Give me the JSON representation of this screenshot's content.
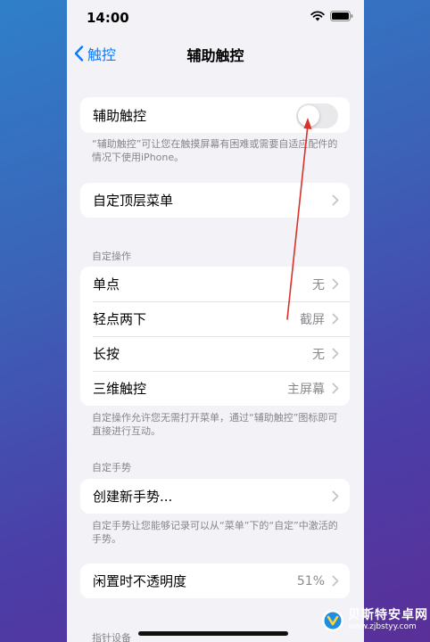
{
  "status_bar": {
    "time": "14:00"
  },
  "nav": {
    "back_label": "触控",
    "title": "辅助触控"
  },
  "assistive_touch": {
    "label": "辅助触控",
    "enabled": false,
    "caption": "“辅助触控”可让您在触摸屏幕有困难或需要自适应配件的情况下使用iPhone。"
  },
  "top_menu": {
    "label": "自定顶层菜单"
  },
  "custom_actions": {
    "header": "自定操作",
    "rows": [
      {
        "label": "单点",
        "value": "无"
      },
      {
        "label": "轻点两下",
        "value": "截屏"
      },
      {
        "label": "长按",
        "value": "无"
      },
      {
        "label": "三维触控",
        "value": "主屏幕"
      }
    ],
    "caption": "自定操作允许您无需打开菜单，通过“辅助触控”图标即可直接进行互动。"
  },
  "custom_gestures": {
    "header": "自定手势",
    "create_label": "创建新手势...",
    "caption": "自定手势让您能够记录可以从“菜单”下的“自定”中激活的手势。"
  },
  "idle_opacity": {
    "label": "闲置时不透明度",
    "value": "51%"
  },
  "pointer_devices": {
    "header": "指针设备"
  },
  "watermark": {
    "name": "贝斯特安卓网",
    "url": "www.zjbstyy.com"
  },
  "colors": {
    "accent": "#0a7aff",
    "arrow": "#d9312b",
    "background": "#f2f2f7"
  }
}
